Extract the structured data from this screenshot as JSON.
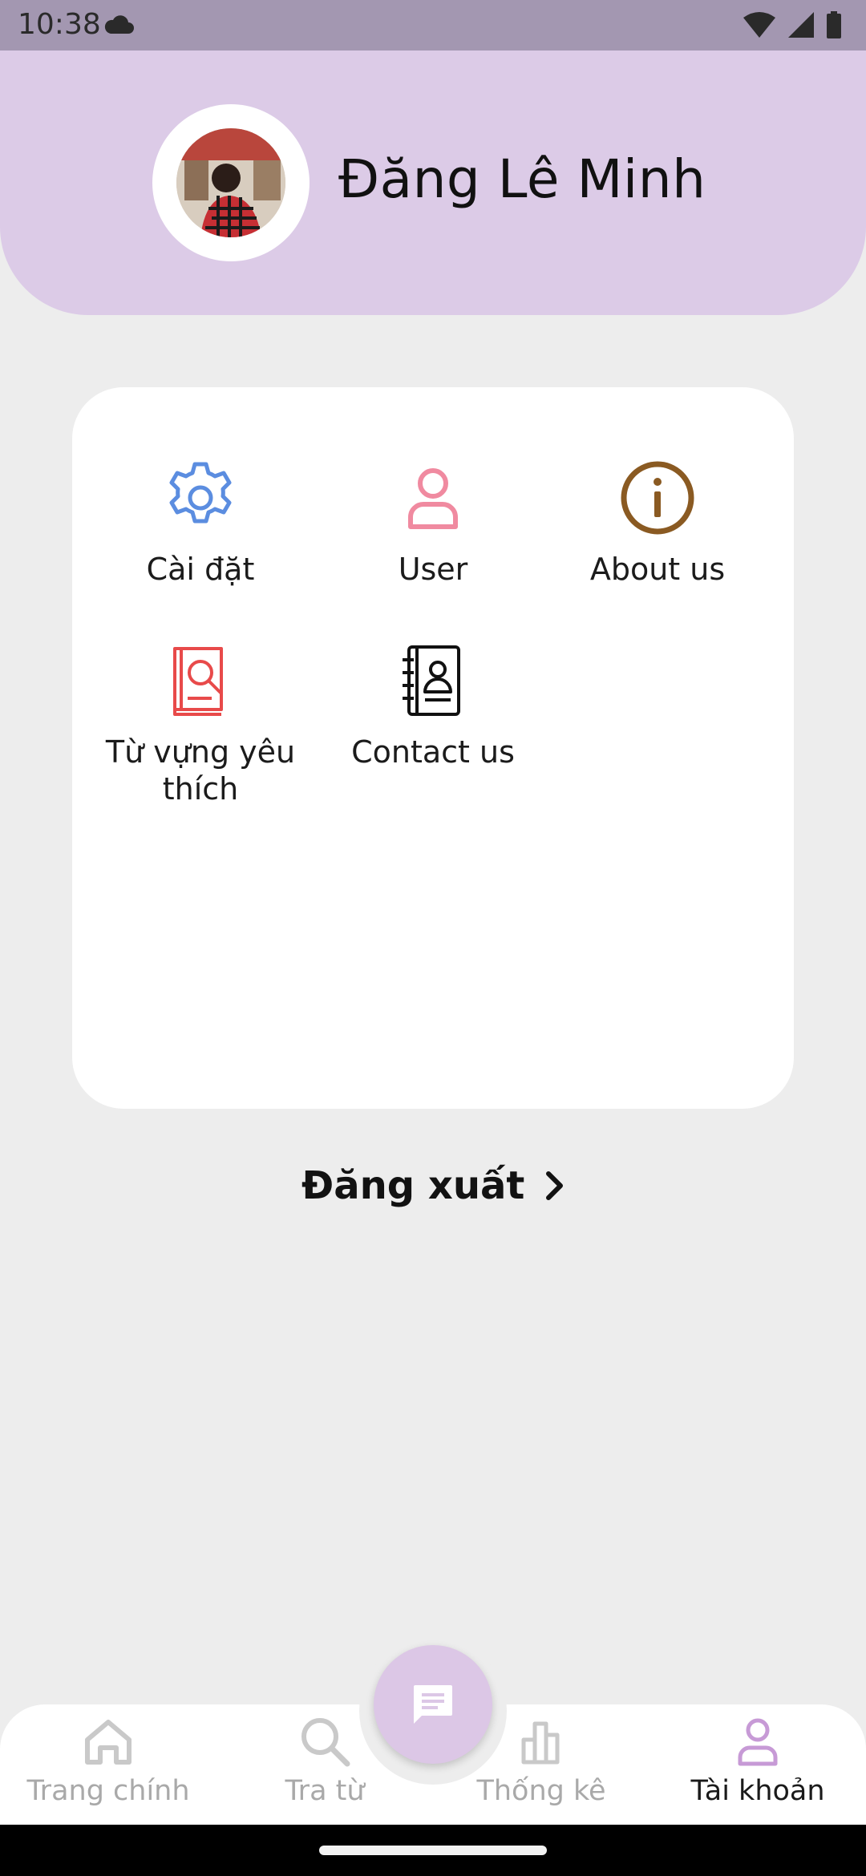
{
  "status_bar": {
    "time": "10:38"
  },
  "profile": {
    "name": "Đăng Lê Minh"
  },
  "menu": {
    "items": [
      {
        "label": "Cài đặt",
        "icon": "gear-icon",
        "color": "#5b8de0"
      },
      {
        "label": "User",
        "icon": "user-icon",
        "color": "#f08aa0"
      },
      {
        "label": "About us",
        "icon": "info-icon",
        "color": "#8a5a22"
      },
      {
        "label": "Từ vựng yêu thích",
        "icon": "book-search-icon",
        "color": "#e84a4a"
      },
      {
        "label": "Contact us",
        "icon": "contact-book-icon",
        "color": "#111111"
      }
    ]
  },
  "logout": {
    "label": "Đăng xuất"
  },
  "bottom_nav": {
    "items": [
      {
        "label": "Trang chính",
        "icon": "home-icon"
      },
      {
        "label": "Tra từ",
        "icon": "search-icon"
      },
      {
        "label": "Thống kê",
        "icon": "bar-chart-icon"
      },
      {
        "label": "Tài khoản",
        "icon": "account-icon",
        "active": true
      }
    ],
    "fab_icon": "chat-icon"
  },
  "colors": {
    "header_bg": "#dccbe7",
    "accent": "#c79ad6",
    "status_bar": "#a397b1"
  }
}
